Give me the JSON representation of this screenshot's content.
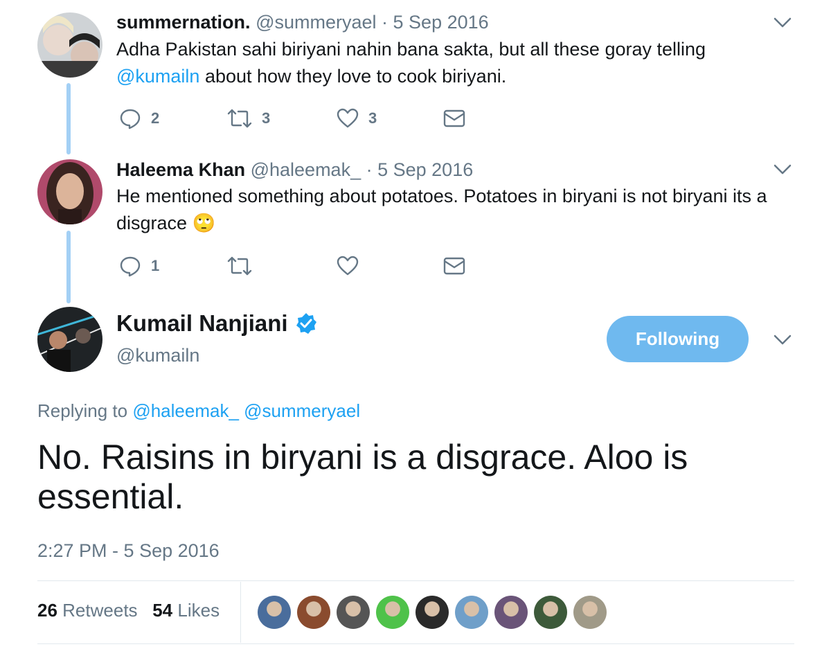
{
  "tweet1": {
    "name": "summernation.",
    "handle": "@summeryael",
    "date": "· 5 Sep 2016",
    "text_part1": "Adha Pakistan sahi biriyani nahin bana sakta, but all these goray telling",
    "mention": "@kumailn",
    "text_part2": " about how they love to cook biriyani.",
    "replies": "2",
    "retweets": "3",
    "likes": "3"
  },
  "tweet2": {
    "name": "Haleema Khan",
    "handle": "@haleemak_",
    "date": "· 5 Sep 2016",
    "text_part1": "He mentioned something about potatoes. Potatoes in biryani is not biryani its a",
    "text_part2": "disgrace",
    "emoji": "🙄",
    "replies": "1"
  },
  "main_tweet": {
    "name": "Kumail Nanjiani",
    "handle": "@kumailn",
    "follow_label": "Following",
    "replying_prefix": "Replying to",
    "replying_to_1": "@haleemak_",
    "replying_to_2": "@summeryael",
    "text": "No. Raisins in biryani is a disgrace. Aloo is essential.",
    "timestamp": "2:27 PM - 5 Sep 2016",
    "retweet_count": "26",
    "retweet_label": "Retweets",
    "like_count": "54",
    "like_label": "Likes"
  },
  "likers": [
    {
      "color": "#4a6d9c"
    },
    {
      "color": "#8a4b2e"
    },
    {
      "color": "#555555"
    },
    {
      "color": "#4fc24a"
    },
    {
      "color": "#2a2a2a"
    },
    {
      "color": "#6f9fc9"
    },
    {
      "color": "#6a5478"
    },
    {
      "color": "#3d5a3a"
    },
    {
      "color": "#a09a88"
    }
  ],
  "colors": {
    "accent": "#1da1f2",
    "follow_button": "#6fb9ef",
    "thread_line": "#a3d0f5",
    "verified": "#1da1f2"
  }
}
